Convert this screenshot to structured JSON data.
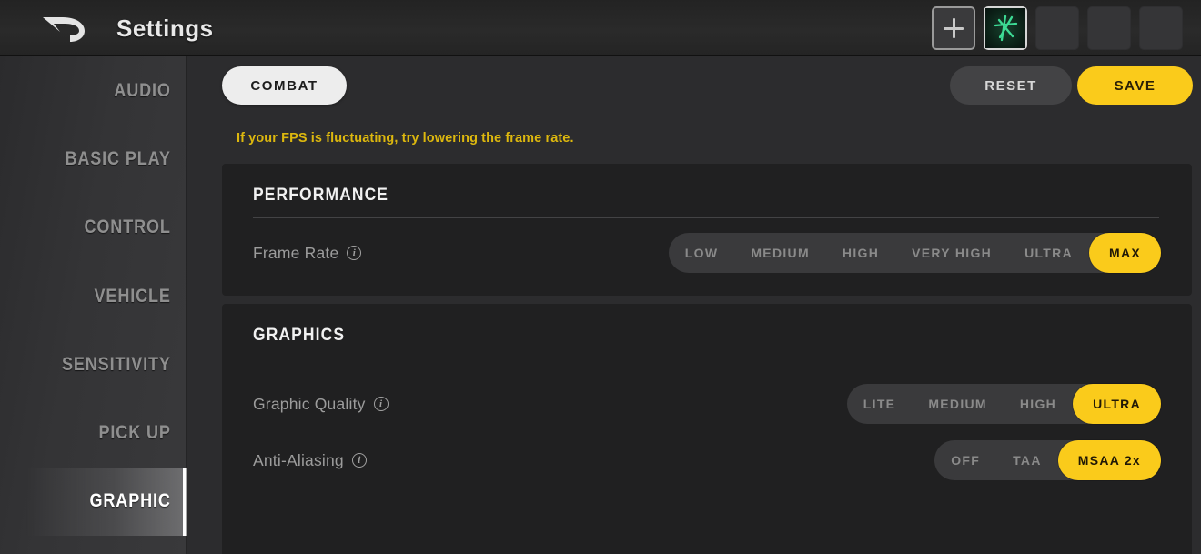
{
  "header": {
    "back_icon": "back-arrow-icon",
    "title": "Settings",
    "slots": [
      {
        "name": "add-slot",
        "icon": "plus-icon",
        "label": ""
      },
      {
        "name": "character-slot",
        "icon": "green-star-glyph-icon",
        "label": "",
        "selected": true
      },
      {
        "name": "empty-slot-1",
        "icon": "",
        "label": ""
      },
      {
        "name": "empty-slot-2",
        "icon": "",
        "label": ""
      },
      {
        "name": "empty-slot-3",
        "icon": "",
        "label": ""
      }
    ]
  },
  "sidebar": {
    "items": [
      {
        "label": "AUDIO",
        "selected": false
      },
      {
        "label": "BASIC PLAY",
        "selected": false
      },
      {
        "label": "CONTROL",
        "selected": false
      },
      {
        "label": "VEHICLE",
        "selected": false
      },
      {
        "label": "SENSITIVITY",
        "selected": false
      },
      {
        "label": "PICK UP",
        "selected": false
      },
      {
        "label": "GRAPHIC",
        "selected": true
      }
    ]
  },
  "toolbar": {
    "tab_label": "COMBAT",
    "reset_label": "RESET",
    "save_label": "SAVE"
  },
  "notice": {
    "text": "If your FPS is fluctuating, try lowering the frame rate."
  },
  "panels": [
    {
      "title": "PERFORMANCE",
      "rows": [
        {
          "label": "Frame Rate",
          "info_icon": "info-icon",
          "options": [
            "LOW",
            "MEDIUM",
            "HIGH",
            "VERY HIGH",
            "ULTRA",
            "MAX"
          ],
          "selected": "MAX"
        }
      ]
    },
    {
      "title": "GRAPHICS",
      "rows": [
        {
          "label": "Graphic Quality",
          "info_icon": "info-icon",
          "options": [
            "LITE",
            "MEDIUM",
            "HIGH",
            "ULTRA"
          ],
          "selected": "ULTRA"
        },
        {
          "label": "Anti-Aliasing",
          "info_icon": "info-icon",
          "options": [
            "OFF",
            "TAA",
            "MSAA 2x"
          ],
          "selected": "MSAA 2x"
        }
      ]
    }
  ],
  "colors": {
    "accent_yellow": "#facb1b",
    "notice_yellow": "#ddb80e",
    "page_bg": "#2c2c2e",
    "panel_bg": "#202021",
    "sidebar_bg": "#343436",
    "segment_track": "#3a3a3c",
    "glyph_green": "#3ddb95"
  }
}
